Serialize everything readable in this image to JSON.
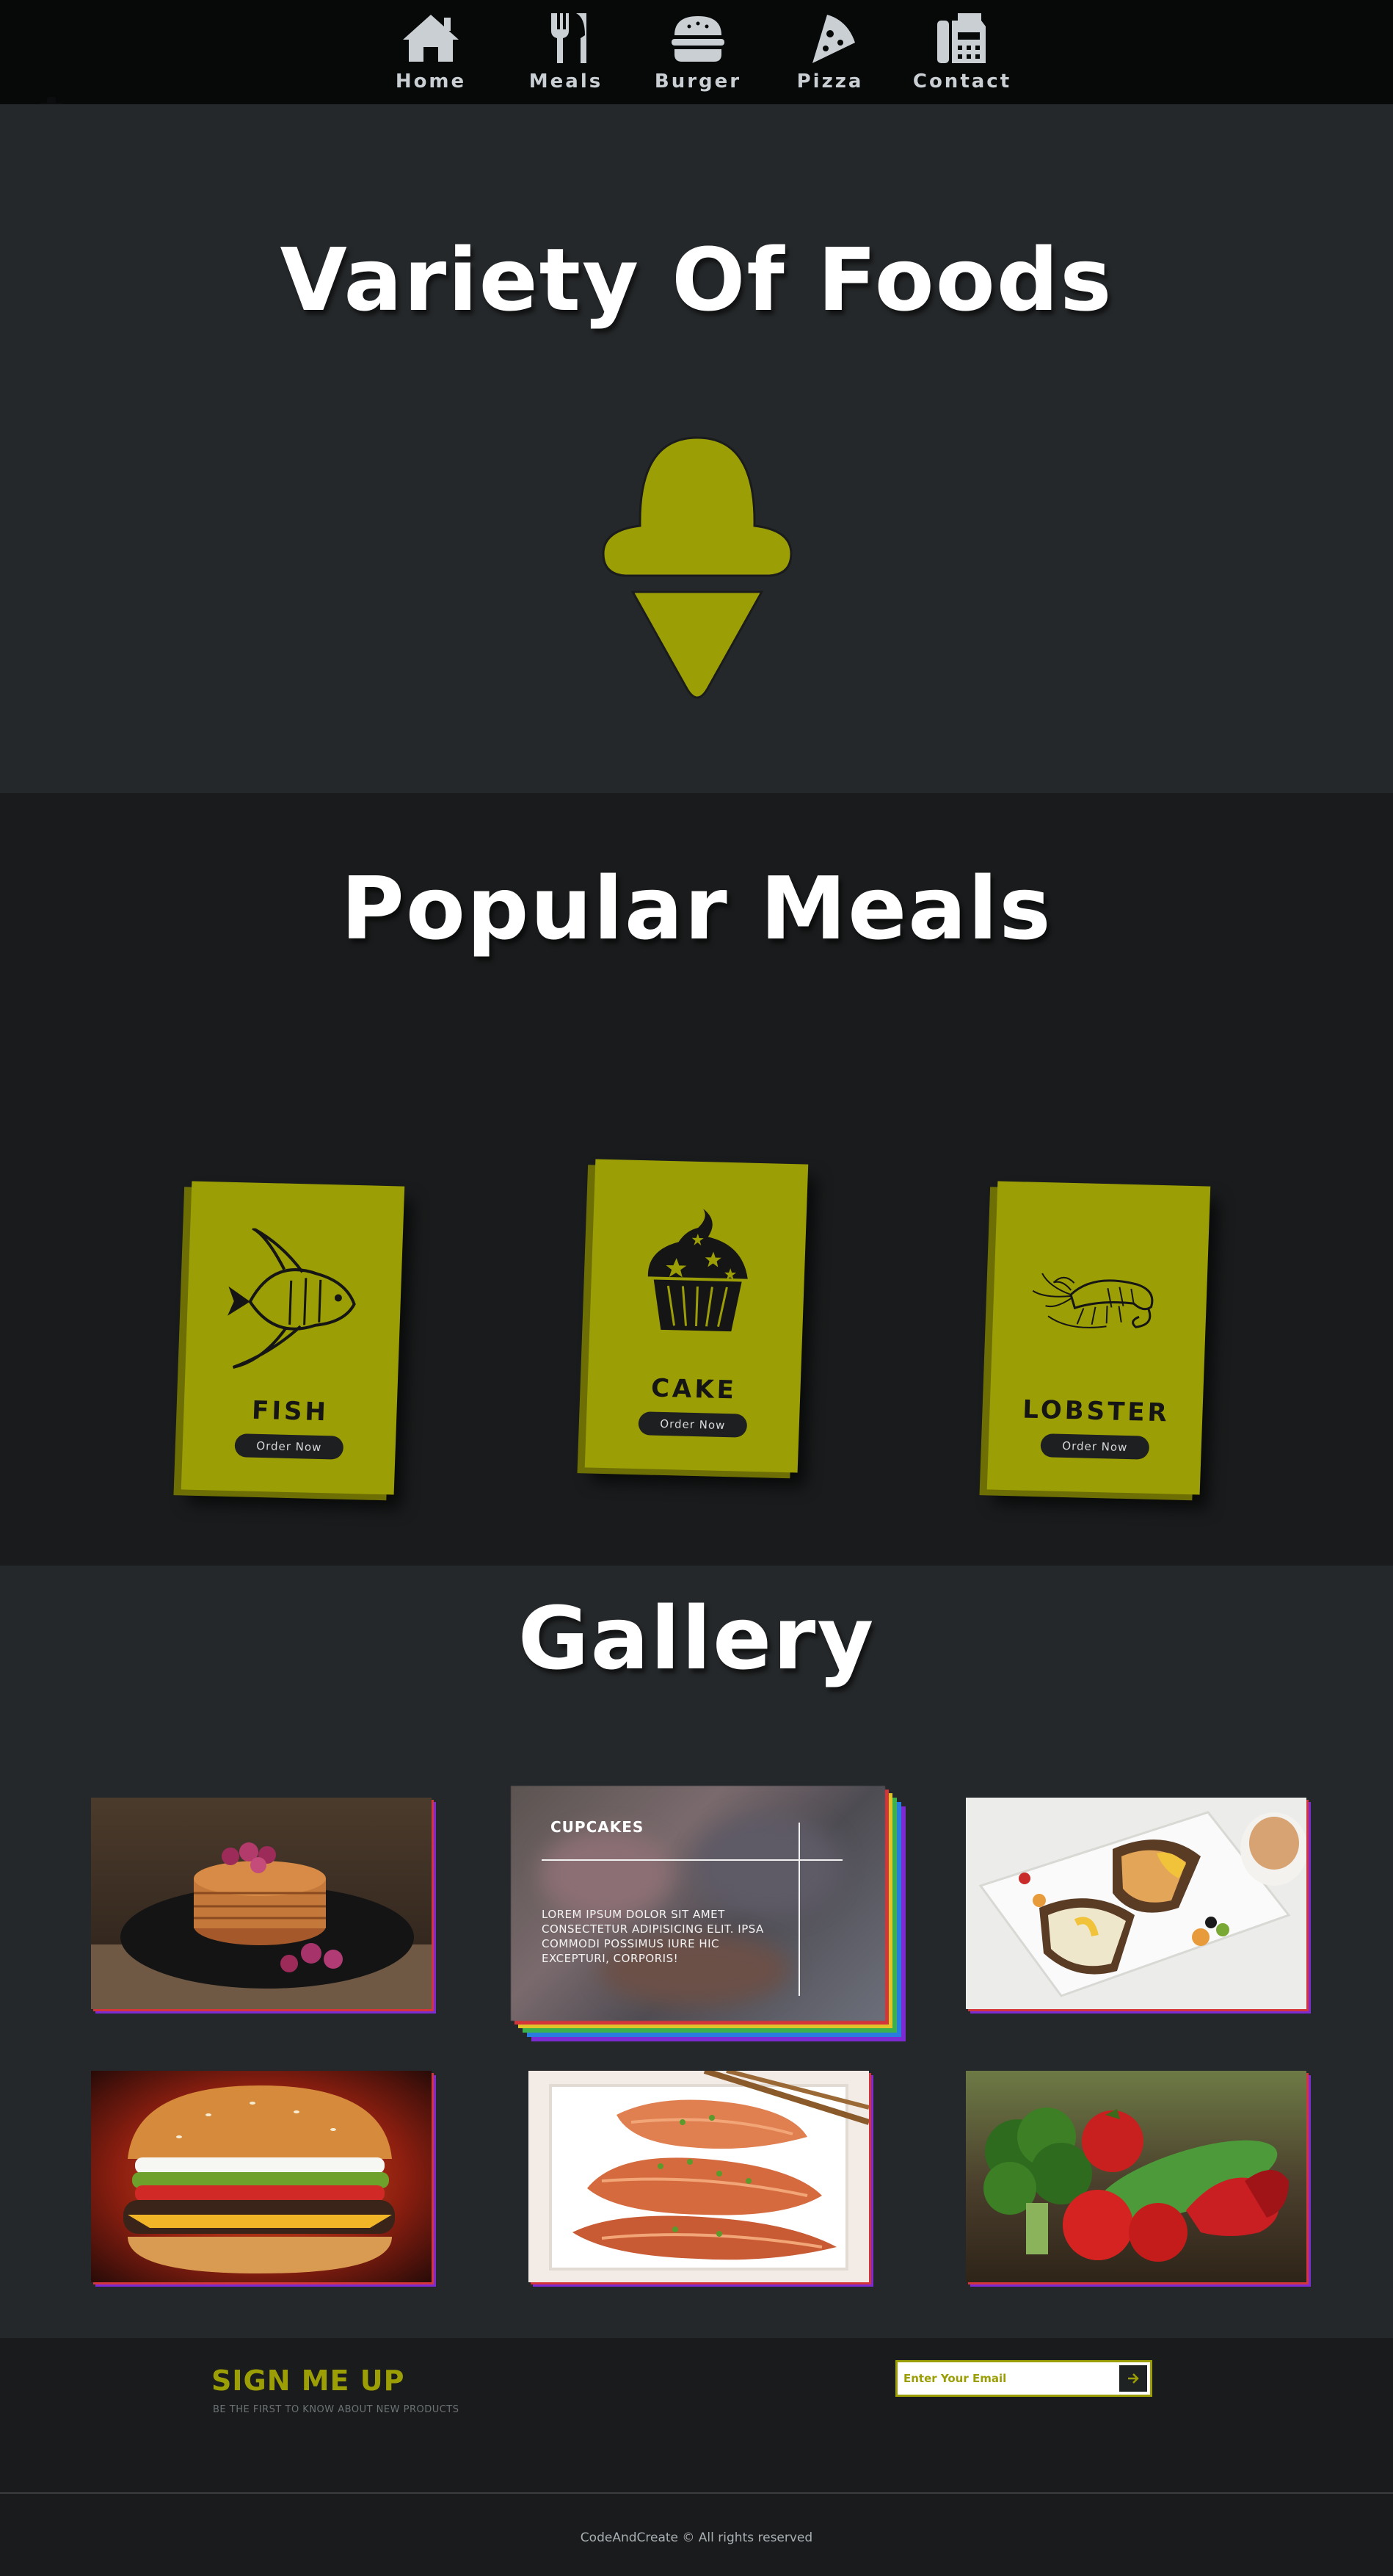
{
  "nav": {
    "items": [
      {
        "label": "Home",
        "icon": "home-icon"
      },
      {
        "label": "Meals",
        "icon": "utensils-icon"
      },
      {
        "label": "Burger",
        "icon": "burger-icon"
      },
      {
        "label": "Pizza",
        "icon": "pizza-icon"
      },
      {
        "label": "Contact",
        "icon": "fax-icon"
      }
    ]
  },
  "hero": {
    "title": "Variety Of Foods",
    "icon": "ice-cream-icon"
  },
  "popular": {
    "title": "Popular Meals",
    "cards": [
      {
        "title": "FISH",
        "button": "Order Now",
        "icon": "fish-icon"
      },
      {
        "title": "CAKE",
        "button": "Order Now",
        "icon": "cupcake-icon"
      },
      {
        "title": "LOBSTER",
        "button": "Order Now",
        "icon": "lobster-icon"
      }
    ]
  },
  "gallery": {
    "title": "Gallery",
    "feature": {
      "title": "CUPCAKES",
      "text": "LOREM IPSUM DOLOR SIT AMET CONSECTETUR ADIPISICING ELIT. IPSA COMMODI POSSIMUS IURE HIC EXCEPTURI, CORPORIS!"
    },
    "photos": [
      "pancakes-photo",
      "sandwich-photo",
      "burger-photo",
      "salmon-photo",
      "vegetables-photo"
    ]
  },
  "signup": {
    "title": "SIGN ME UP",
    "subtitle": "BE THE FIRST TO KNOW ABOUT NEW PRODUCTS",
    "placeholder": "Enter Your Email"
  },
  "footer": {
    "text": "CodeAndCreate © All rights reserved"
  },
  "colors": {
    "accent": "#9c9e06",
    "background": "#25282a",
    "dark": "#191b1c",
    "nav": "#070808"
  }
}
